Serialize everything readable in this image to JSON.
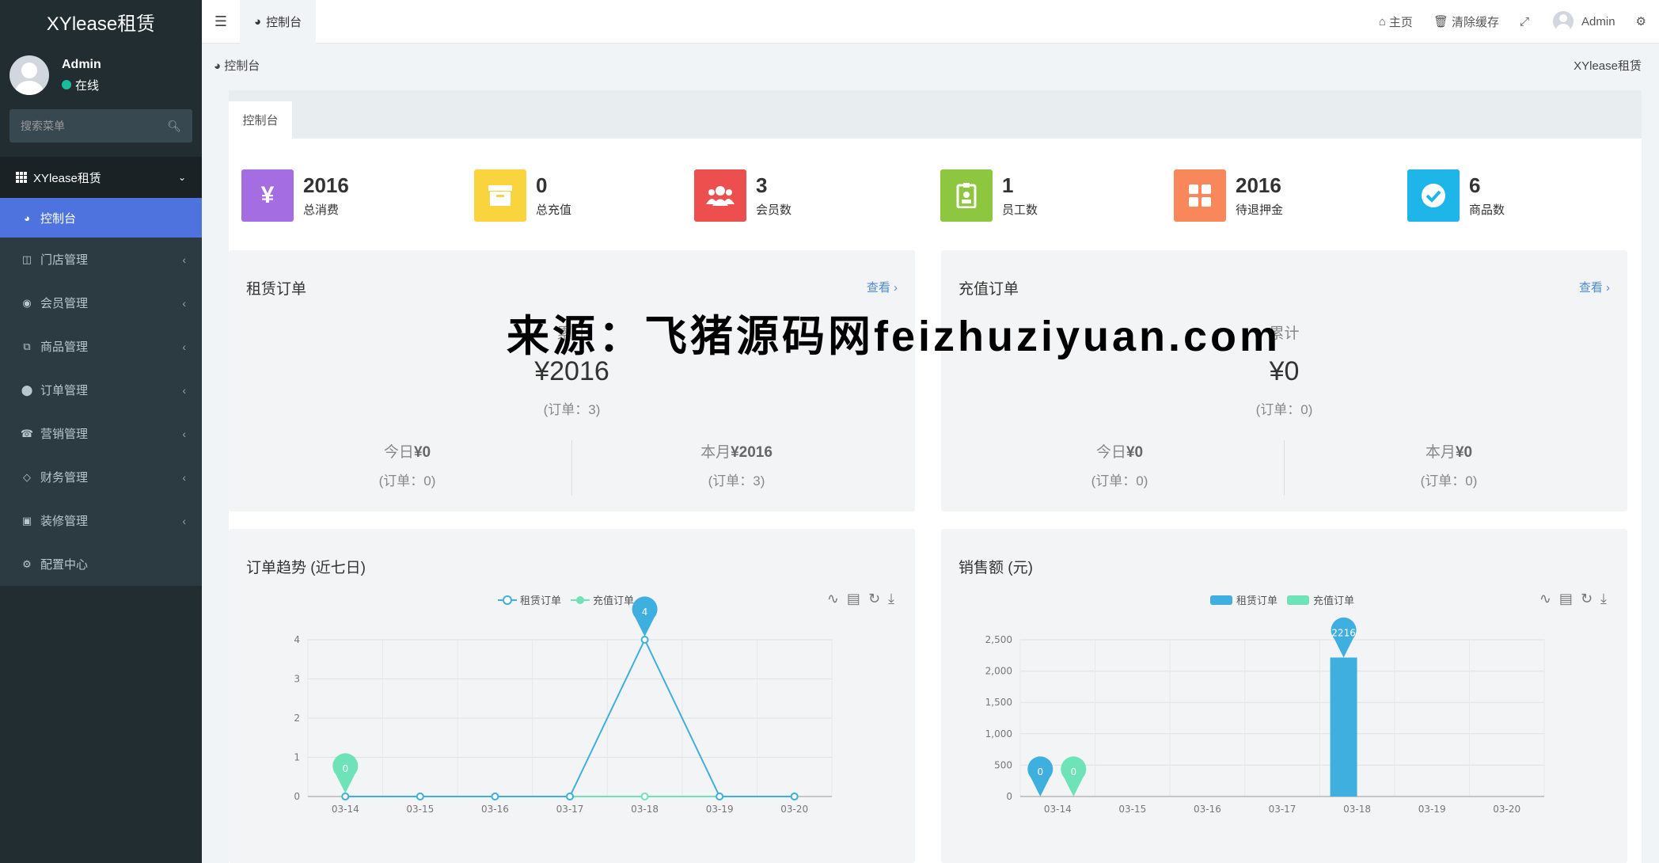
{
  "app": {
    "logo": "XYlease租赁"
  },
  "user": {
    "name": "Admin",
    "status": "在线"
  },
  "search": {
    "placeholder": "搜索菜单"
  },
  "sidebar": {
    "header": "XYlease租赁",
    "items": [
      {
        "label": "控制台",
        "active": true
      },
      {
        "label": "门店管理"
      },
      {
        "label": "会员管理"
      },
      {
        "label": "商品管理"
      },
      {
        "label": "订单管理"
      },
      {
        "label": "营销管理"
      },
      {
        "label": "财务管理"
      },
      {
        "label": "装修管理"
      },
      {
        "label": "配置中心"
      }
    ]
  },
  "topbar": {
    "tab": "控制台",
    "home": "主页",
    "clear_cache": "清除缓存",
    "user": "Admin"
  },
  "breadcrumb": {
    "current": "控制台",
    "site": "XYlease租赁"
  },
  "panel": {
    "tab": "控制台"
  },
  "stats": [
    {
      "value": "2016",
      "label": "总消费",
      "color": "#a56de2",
      "icon": "yen-icon"
    },
    {
      "value": "0",
      "label": "总充值",
      "color": "#f9d43f",
      "icon": "archive-icon"
    },
    {
      "value": "3",
      "label": "会员数",
      "color": "#ed4e4e",
      "icon": "users-icon"
    },
    {
      "value": "1",
      "label": "员工数",
      "color": "#8dc63f",
      "icon": "badge-icon"
    },
    {
      "value": "2016",
      "label": "待退押金",
      "color": "#f8875c",
      "icon": "grid-icon"
    },
    {
      "value": "6",
      "label": "商品数",
      "color": "#1eb6e8",
      "icon": "check-icon"
    }
  ],
  "lease_card": {
    "title": "租赁订单",
    "link": "查看 ›",
    "subtitle": "累计",
    "total": "¥2016",
    "orders": "(订单：3)",
    "today_label": "今日",
    "today_value": "¥0",
    "today_orders": "(订单：0)",
    "month_label": "本月",
    "month_value": "¥2016",
    "month_orders": "(订单：3)"
  },
  "recharge_card": {
    "title": "充值订单",
    "link": "查看 ›",
    "subtitle": "累计",
    "total": "¥0",
    "orders": "(订单：0)",
    "today_label": "今日",
    "today_value": "¥0",
    "today_orders": "(订单：0)",
    "month_label": "本月",
    "month_value": "¥0",
    "month_orders": "(订单：0)"
  },
  "trend_card": {
    "title": "订单趋势 (近七日)"
  },
  "sales_card": {
    "title": "销售额 (元)"
  },
  "watermark_text": "来源：飞猪源码网feizhuziyuan.com",
  "colors": {
    "accent": "#4e73df",
    "lease": "#3fafe0",
    "recharge": "#6ee3b8"
  },
  "chart_data": [
    {
      "type": "line",
      "title": "订单趋势 (近七日)",
      "categories": [
        "03-14",
        "03-15",
        "03-16",
        "03-17",
        "03-18",
        "03-19",
        "03-20"
      ],
      "series": [
        {
          "name": "租赁订单",
          "values": [
            0,
            0,
            0,
            0,
            4,
            0,
            0
          ]
        },
        {
          "name": "充值订单",
          "values": [
            0,
            0,
            0,
            0,
            0,
            0,
            0
          ]
        }
      ],
      "ylim": [
        0,
        4
      ],
      "yticks": [
        0,
        1,
        2,
        3,
        4
      ],
      "markers": [
        {
          "series": "租赁订单",
          "index": 4,
          "label": "4"
        },
        {
          "series": "充值订单",
          "index": 0,
          "label": "0"
        }
      ],
      "legend": "top-center"
    },
    {
      "type": "bar",
      "title": "销售额 (元)",
      "categories": [
        "03-14",
        "03-15",
        "03-16",
        "03-17",
        "03-18",
        "03-19",
        "03-20"
      ],
      "series": [
        {
          "name": "租赁订单",
          "values": [
            0,
            0,
            0,
            0,
            2216,
            0,
            0
          ]
        },
        {
          "name": "充值订单",
          "values": [
            0,
            0,
            0,
            0,
            0,
            0,
            0
          ]
        }
      ],
      "ylim": [
        0,
        2500
      ],
      "yticks": [
        "0",
        "500",
        "1,000",
        "1,500",
        "2,000",
        "2,500"
      ],
      "markers": [
        {
          "series": "租赁订单",
          "index": 0,
          "label": "0"
        },
        {
          "series": "充值订单",
          "index": 0,
          "label": "0"
        },
        {
          "series": "租赁订单",
          "index": 4,
          "label": "2216"
        }
      ],
      "legend": "top-center"
    }
  ]
}
